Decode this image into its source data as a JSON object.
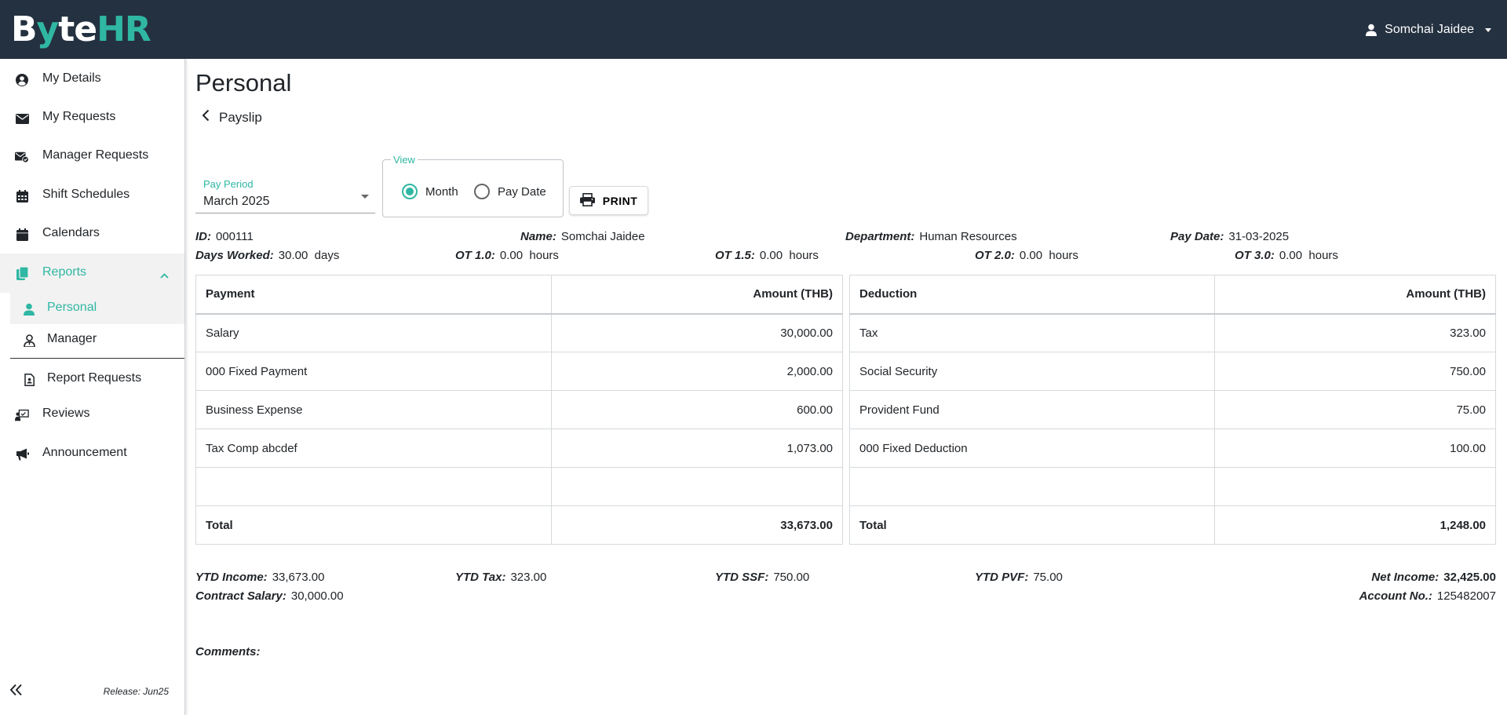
{
  "app": {
    "logo_text_b": "B",
    "logo_text_y": "y",
    "logo_text_te": "te",
    "logo_text_hr": "HR"
  },
  "user": {
    "name": "Somchai Jaidee"
  },
  "sidebar": {
    "items": [
      {
        "label": "My Details",
        "icon": "user-circle-icon"
      },
      {
        "label": "My Requests",
        "icon": "envelope-icon"
      },
      {
        "label": "Manager Requests",
        "icon": "envelope-check-icon"
      },
      {
        "label": "Shift Schedules",
        "icon": "calendar-grid-icon"
      },
      {
        "label": "Calendars",
        "icon": "calendar-icon"
      }
    ],
    "reports": {
      "label": "Reports",
      "icon": "copy-icon"
    },
    "reports_sub": [
      {
        "label": "Personal",
        "icon": "user-icon"
      },
      {
        "label": "Manager",
        "icon": "user-tie-icon"
      }
    ],
    "report_requests": {
      "label": "Report Requests",
      "icon": "file-user-icon"
    },
    "more": [
      {
        "label": "Reviews",
        "icon": "chalkboard-user-icon"
      },
      {
        "label": "Announcement",
        "icon": "bullhorn-icon"
      }
    ],
    "release": "Release: Jun25"
  },
  "page": {
    "title": "Personal",
    "back_label": "Payslip"
  },
  "filters": {
    "pay_period_label": "Pay Period",
    "pay_period_value": "March 2025",
    "view_label": "View",
    "view_options": [
      "Month",
      "Pay Date"
    ],
    "view_selected": "Month",
    "print_label": "PRINT"
  },
  "info": {
    "id_label": "ID:",
    "id_value": "000111",
    "name_label": "Name:",
    "name_value": "Somchai Jaidee",
    "dept_label": "Department:",
    "dept_value": "Human Resources",
    "paydate_label": "Pay Date:",
    "paydate_value": "31-03-2025",
    "days_label": "Days Worked:",
    "days_value": "30.00",
    "days_unit": "days",
    "ot10_label": "OT 1.0:",
    "ot10_value": "0.00",
    "ot15_label": "OT 1.5:",
    "ot15_value": "0.00",
    "ot20_label": "OT 2.0:",
    "ot20_value": "0.00",
    "ot30_label": "OT 3.0:",
    "ot30_value": "0.00",
    "hours_unit": "hours"
  },
  "payments": {
    "header": [
      "Payment",
      "Amount (THB)"
    ],
    "rows": [
      [
        "Salary",
        "30,000.00"
      ],
      [
        "000 Fixed Payment",
        "2,000.00"
      ],
      [
        "Business Expense",
        "600.00"
      ],
      [
        "Tax Comp abcdef",
        "1,073.00"
      ],
      [
        "",
        ""
      ]
    ],
    "total": [
      "Total",
      "33,673.00"
    ]
  },
  "deductions": {
    "header": [
      "Deduction",
      "Amount (THB)"
    ],
    "rows": [
      [
        "Tax",
        "323.00"
      ],
      [
        "Social Security",
        "750.00"
      ],
      [
        "Provident Fund",
        "75.00"
      ],
      [
        "000 Fixed Deduction",
        "100.00"
      ],
      [
        "",
        ""
      ]
    ],
    "total": [
      "Total",
      "1,248.00"
    ]
  },
  "summary": {
    "ytd_income_label": "YTD Income:",
    "ytd_income": "33,673.00",
    "ytd_tax_label": "YTD Tax:",
    "ytd_tax": "323.00",
    "ytd_ssf_label": "YTD SSF:",
    "ytd_ssf": "750.00",
    "ytd_pvf_label": "YTD PVF:",
    "ytd_pvf": "75.00",
    "net_income_label": "Net Income:",
    "net_income": "32,425.00",
    "contract_label": "Contract Salary:",
    "contract": "30,000.00",
    "account_label": "Account No.:",
    "account": "125482007"
  },
  "comments_label": "Comments:",
  "colors": {
    "accent": "#2fb7a3",
    "topbar": "#243140"
  }
}
